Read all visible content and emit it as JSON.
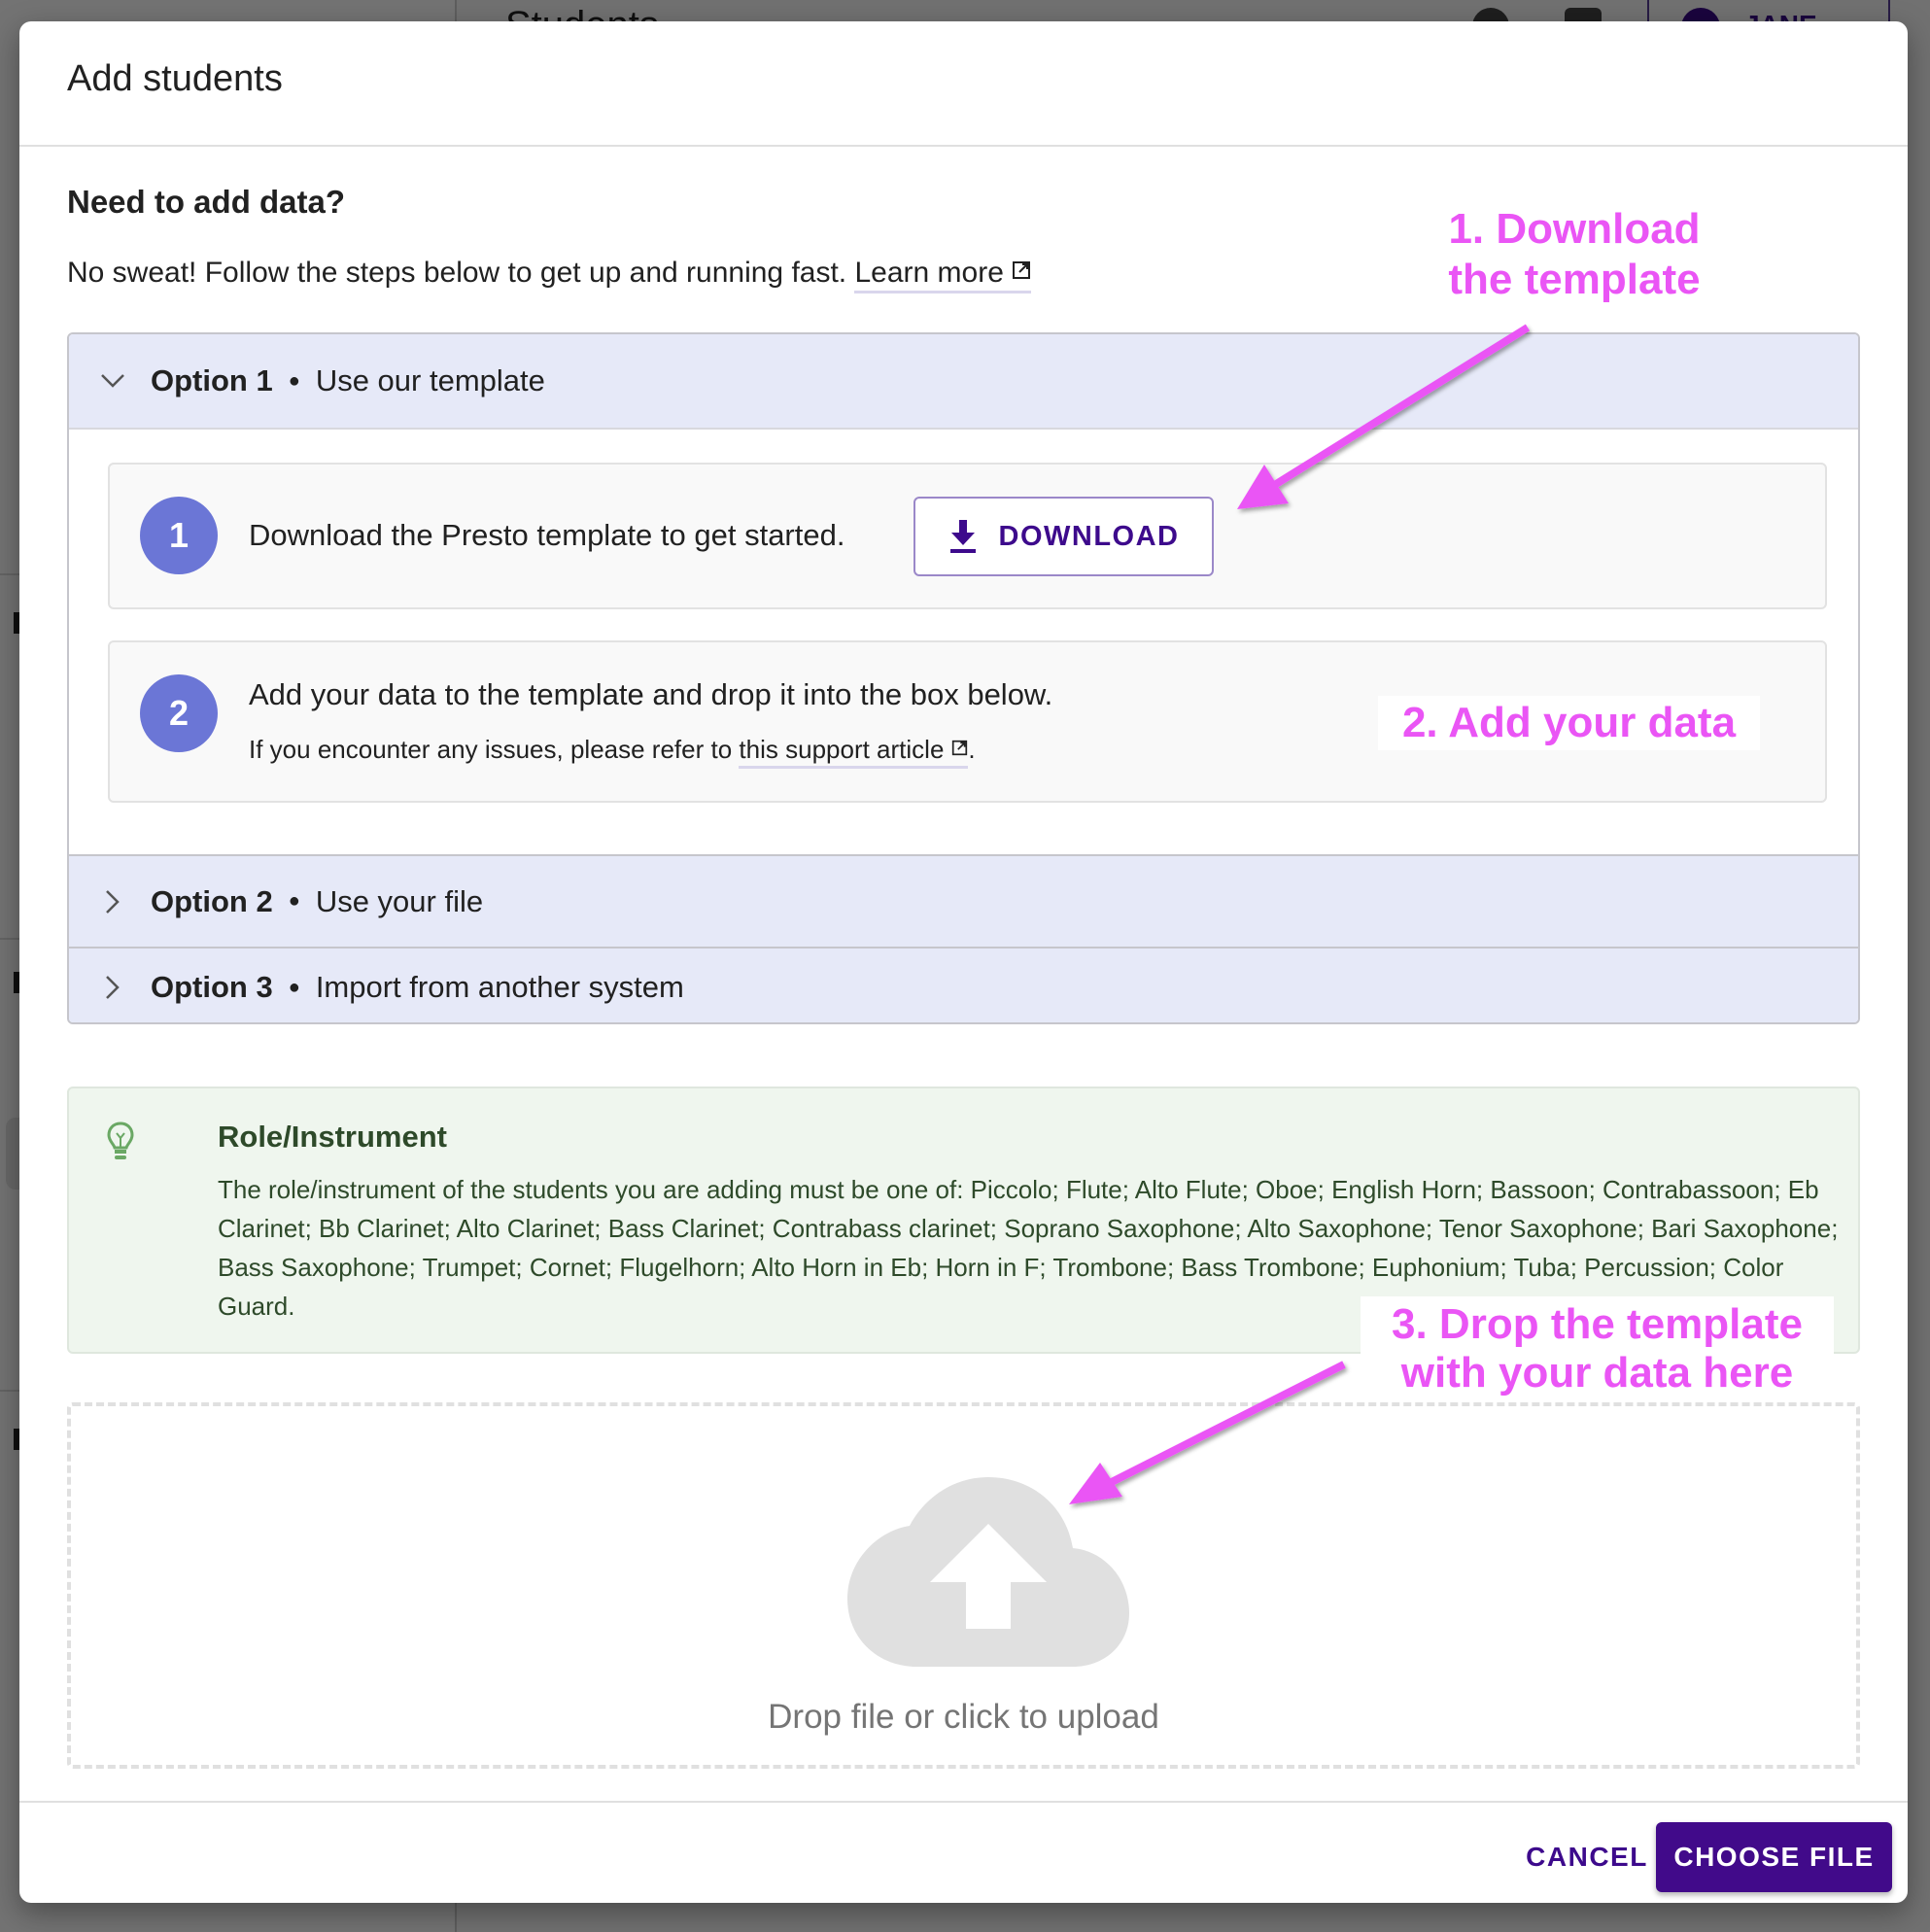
{
  "background": {
    "page_title": "Students",
    "user_name": "JANE"
  },
  "modal": {
    "title": "Add students",
    "section_title": "Need to add data?",
    "intro_text": "No sweat! Follow the steps below to get up and running fast.",
    "learn_more_label": "Learn more",
    "options": [
      {
        "label": "Option 1",
        "description": "Use our template",
        "expanded": true
      },
      {
        "label": "Option 2",
        "description": "Use your file",
        "expanded": false
      },
      {
        "label": "Option 3",
        "description": "Import from another system",
        "expanded": false
      }
    ],
    "steps": [
      {
        "number": "1",
        "text": "Download the Presto template to get started.",
        "button_label": "DOWNLOAD"
      },
      {
        "number": "2",
        "text": "Add your data to the template and drop it into the box below.",
        "sub_text_prefix": "If you encounter any issues, please refer to",
        "sub_link_label": "this support article",
        "sub_text_suffix": "."
      }
    ],
    "tip": {
      "title": "Role/Instrument",
      "body": "The role/instrument of the students you are adding must be one of: Piccolo; Flute; Alto Flute; Oboe; English Horn; Bassoon; Contrabassoon; Eb Clarinet; Bb Clarinet; Alto Clarinet; Bass Clarinet; Contrabass clarinet; Soprano Saxophone; Alto Saxophone; Tenor Saxophone; Bari Saxophone; Bass Saxophone; Trumpet; Cornet; Flugelhorn; Alto Horn in Eb; Horn in F; Trombone; Bass Trombone; Euphonium; Tuba; Percussion; Color Guard."
    },
    "dropzone_text": "Drop file or click to upload",
    "footer": {
      "cancel_label": "CANCEL",
      "choose_file_label": "CHOOSE FILE"
    }
  },
  "annotations": {
    "step1": "1. Download the template",
    "step2": "2. Add your data",
    "step3": "3. Drop the template with your data here"
  },
  "colors": {
    "primary": "#410a8a",
    "step_circle": "#6b76d6",
    "accordion_header": "#e6e9f8",
    "tip_background": "#eff6ee",
    "tip_text": "#2e4a2a",
    "annotation": "#ea55f5"
  }
}
